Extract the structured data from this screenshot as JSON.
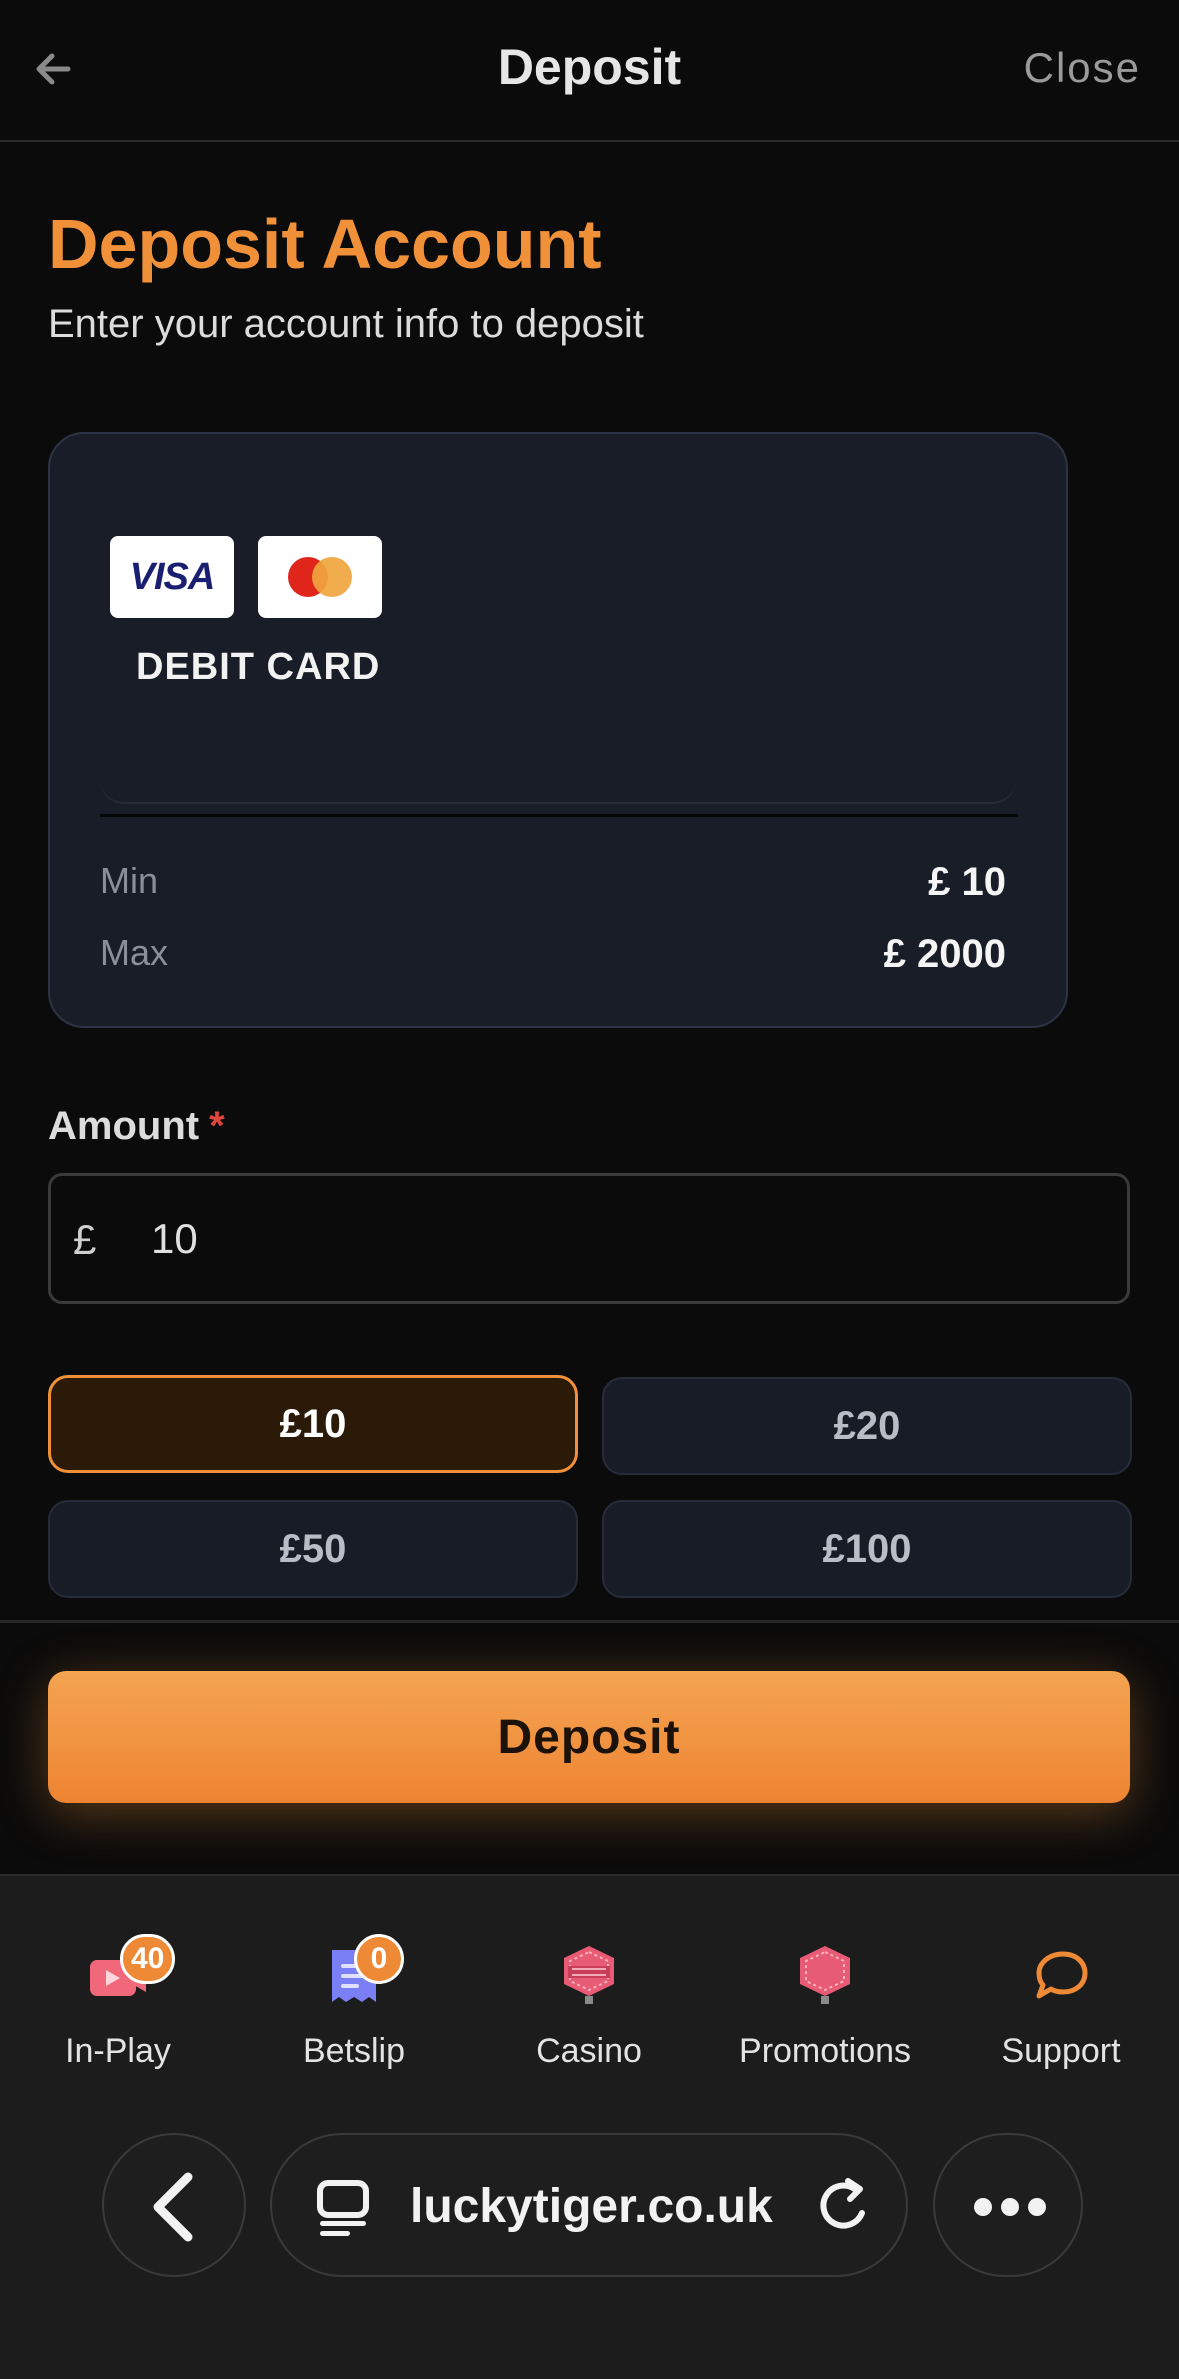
{
  "header": {
    "title": "Deposit",
    "close_label": "Close"
  },
  "page": {
    "heading": "Deposit Account",
    "subheading": "Enter your account info to deposit"
  },
  "payment_method": {
    "logos": [
      "visa-logo",
      "mastercard-logo"
    ],
    "visa_text": "VISA",
    "label": "DEBIT CARD",
    "min_label": "Min",
    "min_value": "£ 10",
    "max_label": "Max",
    "max_value": "£ 2000"
  },
  "amount": {
    "label": "Amount",
    "required_mark": "*",
    "currency_symbol": "£",
    "value": "10"
  },
  "presets": [
    {
      "label": "£10",
      "selected": true
    },
    {
      "label": "£20",
      "selected": false
    },
    {
      "label": "£50",
      "selected": false
    },
    {
      "label": "£100",
      "selected": false
    }
  ],
  "deposit_button": "Deposit",
  "nav": [
    {
      "label": "In-Play",
      "badge": "40",
      "icon": "video-play-icon"
    },
    {
      "label": "Betslip",
      "badge": "0",
      "icon": "receipt-icon"
    },
    {
      "label": "Casino",
      "icon": "casino-chip-icon"
    },
    {
      "label": "Promotions",
      "icon": "promotions-icon"
    },
    {
      "label": "Support",
      "icon": "chat-bubble-icon"
    }
  ],
  "browser": {
    "url": "luckytiger.co.uk"
  },
  "colors": {
    "accent": "#f0913a",
    "background": "#0b0b0b",
    "card": "#191d28",
    "required": "#e0453a"
  }
}
